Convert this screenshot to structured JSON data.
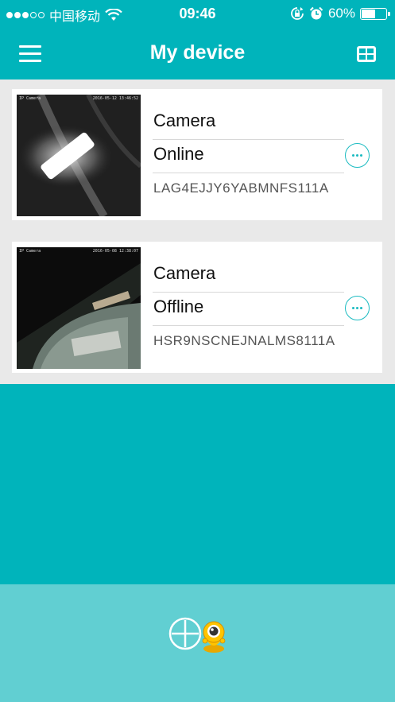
{
  "status_bar": {
    "carrier": "中国移动",
    "time": "09:46",
    "battery_percent": "60%",
    "battery_level": 0.6,
    "icons": [
      "signal-icon",
      "wifi-icon",
      "orientation-lock-icon",
      "alarm-icon",
      "battery-icon"
    ]
  },
  "nav": {
    "title": "My device",
    "left_icon": "menu-icon",
    "right_icon": "grid-view-icon"
  },
  "devices": [
    {
      "name": "Camera",
      "status": "Online",
      "uid": "LAG4EJJY6YABMNFS111A",
      "thumb_timestamp": "2016-05-12 13:46:52",
      "thumb_label": "IP Camera"
    },
    {
      "name": "Camera",
      "status": "Offline",
      "uid": "HSR9NSCNEJNALMS8111A",
      "thumb_timestamp": "2016-05-08 12:38:07",
      "thumb_label": "IP Camera"
    }
  ],
  "bottom": {
    "add_icon": "add-device-icon",
    "mascot_icon": "mascot-camera-icon"
  },
  "colors": {
    "primary": "#00b4bb",
    "bottom_bar": "#61cfd2",
    "list_bg": "#e9e9e9",
    "accent": "#1bbbc1"
  }
}
